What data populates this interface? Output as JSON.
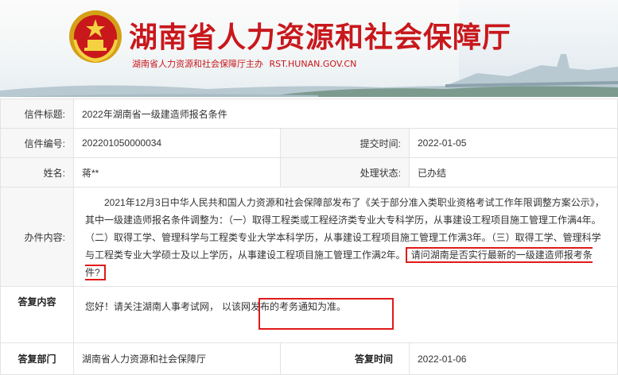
{
  "header": {
    "title": "湖南省人力资源和社会保障厅",
    "subtitle": "湖南省人力资源和社会保障厅主办",
    "domain": "RST.HUNAN.GOV.CN"
  },
  "letter": {
    "title_label": "信件标题:",
    "title_value": "2022年湖南省一级建造师报名条件",
    "number_label": "信件编号:",
    "number_value": "202201050000034",
    "submit_time_label": "提交时间:",
    "submit_time_value": "2022-01-05",
    "name_label": "姓名:",
    "name_value": "蒋**",
    "status_label": "处理状态:",
    "status_value": "已办结",
    "content_label": "办件内容:",
    "content_text": "2021年12月3日中华人民共和国人力资源和社会保障部发布了《关于部分准入类职业资格考试工作年限调整方案公示》，其中一级建造师报名条件调整为：（一）取得工程类或工程经济类专业大专科学历，从事建设工程项目施工管理工作满4年。（二）取得工学、管理科学与工程类专业大学本科学历，从事建设工程项目施工管理工作满3年。（三）取得工学、管理科学与工程类专业大学硕士及以上学历，从事建设工程项目施工管理工作满2年。",
    "content_question": "请问湖南是否实行最新的一级建造师报考条件?"
  },
  "reply": {
    "label": "答复内容",
    "text_prefix": "您好！请关注湖南人事考试网，",
    "text_highlight": "以该网发布的考务通知为准。",
    "dept_label": "答复部门",
    "dept_value": "湖南省人力资源和社会保障厅",
    "time_label": "答复时间",
    "time_value": "2022-01-06"
  },
  "colors": {
    "brand_red": "#c8181c",
    "highlight_red": "#e01a1a"
  }
}
